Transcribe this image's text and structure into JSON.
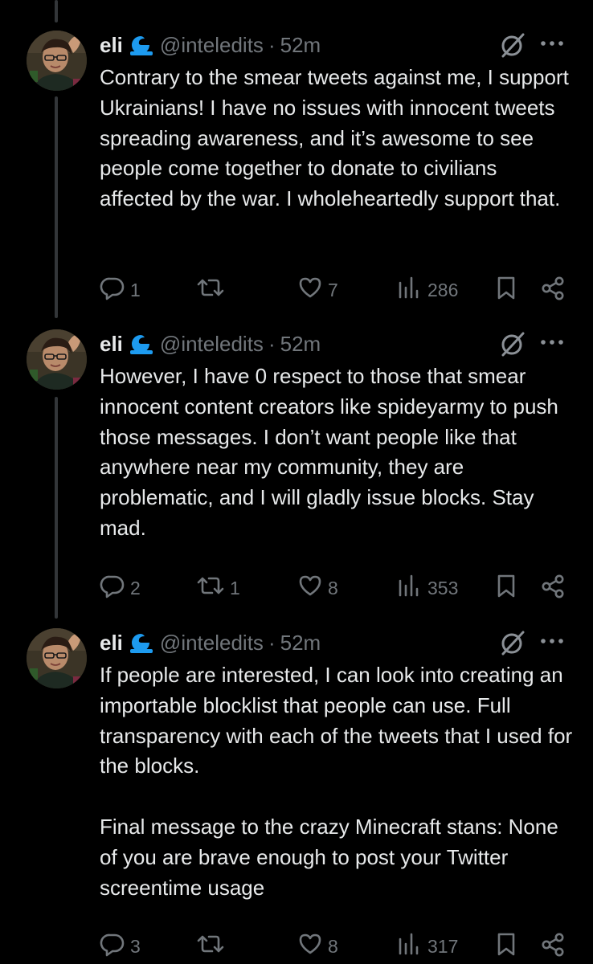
{
  "colors": {
    "background": "#000000",
    "text_primary": "#e7e9ea",
    "text_secondary": "#71767b",
    "thread_line": "#333639",
    "badge_blue": "#1d9bf0"
  },
  "tweets": [
    {
      "display_name": "eli",
      "badge_icon": "blue-wave-badge-icon",
      "handle": "@inteledits",
      "separator": "·",
      "time": "52m",
      "text": "Contrary to the smear tweets against me, I support Ukrainians! I have no issues with innocent tweets spreading awareness, and it’s awesome to see people come together to donate to civilians affected by the war. I wholeheartedly support that.",
      "replies": "1",
      "retweets": "",
      "likes": "7",
      "views": "286"
    },
    {
      "display_name": "eli",
      "badge_icon": "blue-wave-badge-icon",
      "handle": "@inteledits",
      "separator": "·",
      "time": "52m",
      "text": "However, I have 0 respect to those that smear innocent content creators like spideyarmy to push those messages. I don’t want people like that anywhere near my community, they are problematic, and I will gladly issue blocks. Stay mad.",
      "replies": "2",
      "retweets": "1",
      "likes": "8",
      "views": "353"
    },
    {
      "display_name": "eli",
      "badge_icon": "blue-wave-badge-icon",
      "handle": "@inteledits",
      "separator": "·",
      "time": "52m",
      "text": "If people are interested, I can look into creating an importable blocklist that people can use. Full transparency with each of the tweets that I used for the blocks.\n\nFinal message to the crazy Minecraft stans: None of you are brave enough to post your Twitter screentime usage",
      "replies": "3",
      "retweets": "",
      "likes": "8",
      "views": "317"
    }
  ]
}
